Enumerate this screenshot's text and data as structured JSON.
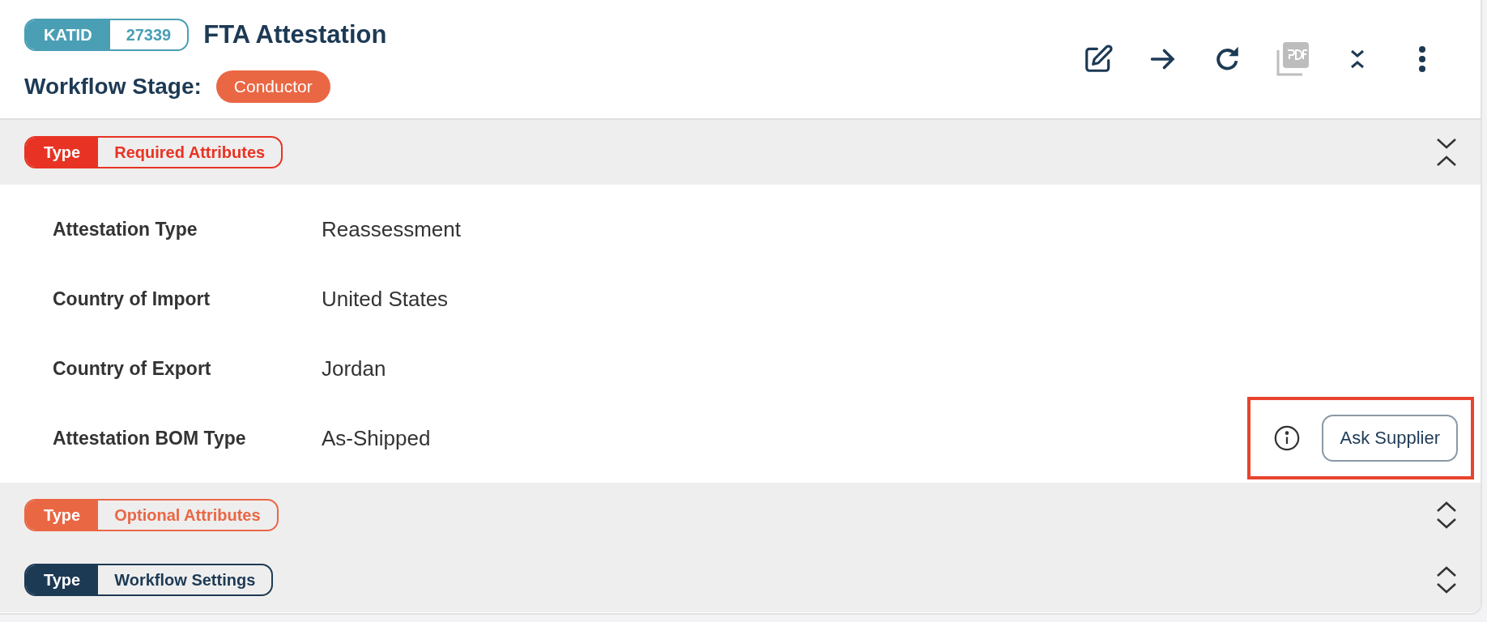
{
  "header": {
    "id_badge": {
      "label": "KATID",
      "value": "27339"
    },
    "title": "FTA Attestation",
    "stage_label": "Workflow Stage:",
    "stage": "Conductor",
    "toolbar": [
      {
        "kind": "edit",
        "disabled": false
      },
      {
        "kind": "forward",
        "disabled": false
      },
      {
        "kind": "refresh",
        "disabled": false
      },
      {
        "kind": "pdf",
        "disabled": true
      },
      {
        "kind": "collapse",
        "disabled": false
      },
      {
        "kind": "more",
        "disabled": false
      }
    ]
  },
  "sections": [
    {
      "tag": "Type",
      "name": "Required Attributes",
      "color": "#e83324",
      "expanded": true,
      "fields": [
        {
          "label": "Attestation Type",
          "value": "Reassessment"
        },
        {
          "label": "Country of Import",
          "value": "United States"
        },
        {
          "label": "Country of Export",
          "value": "Jordan"
        },
        {
          "label": "Attestation BOM Type",
          "value": "As-Shipped",
          "action": {
            "label": "Ask Supplier",
            "highlighted": true
          }
        }
      ]
    },
    {
      "tag": "Type",
      "name": "Optional Attributes",
      "color": "#ea6744",
      "expanded": false
    },
    {
      "tag": "Type",
      "name": "Workflow Settings",
      "color": "#1d3a55",
      "expanded": false
    }
  ]
}
